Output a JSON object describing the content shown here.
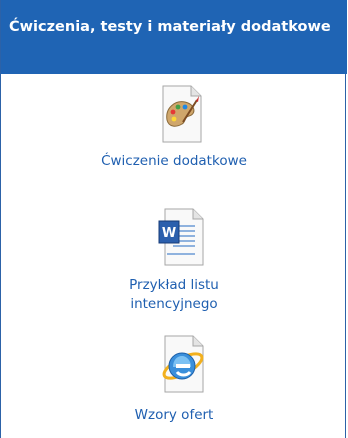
{
  "panel": {
    "title": "Ćwiczenia, testy i materiały dodatkowe"
  },
  "items": [
    {
      "label": "Ćwiczenie dodatkowe",
      "icon": "paint-document-icon"
    },
    {
      "label": "Przykład listu intencyjnego",
      "icon": "word-document-icon"
    },
    {
      "label": "Wzory ofert",
      "icon": "internet-explorer-document-icon"
    }
  ],
  "colors": {
    "header_background": "#1f64b4",
    "link": "#1f5fb0",
    "panel_border": "#2c62a8"
  }
}
